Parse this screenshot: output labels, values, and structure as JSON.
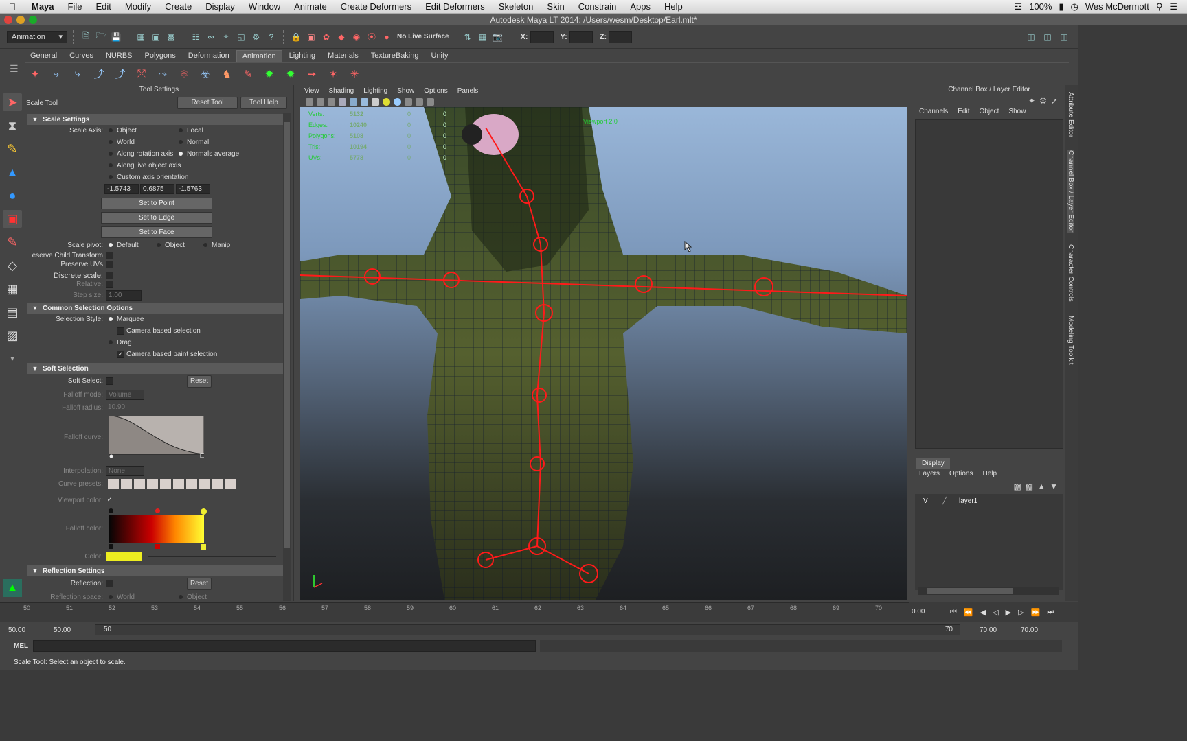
{
  "menubar": {
    "items": [
      "Maya",
      "File",
      "Edit",
      "Modify",
      "Create",
      "Display",
      "Window",
      "Animate",
      "Create Deformers",
      "Edit Deformers",
      "Skeleton",
      "Skin",
      "Constrain",
      "Apps",
      "Help"
    ],
    "battery": "100%",
    "user": "Wes McDermott"
  },
  "window": {
    "title": "Autodesk Maya LT 2014: /Users/wesm/Desktop/Earl.mlt*"
  },
  "statusline": {
    "mode": "Animation",
    "live_surface": "No Live Surface",
    "x_label": "X:",
    "y_label": "Y:",
    "z_label": "Z:"
  },
  "shelf": {
    "tabs": [
      "General",
      "Curves",
      "NURBS",
      "Polygons",
      "Deformation",
      "Animation",
      "Lighting",
      "Materials",
      "TextureBaking",
      "Unity"
    ],
    "active_tab": "Animation"
  },
  "tool_settings": {
    "header": "Tool Settings",
    "tool_name": "Scale Tool",
    "reset_tool": "Reset Tool",
    "tool_help": "Tool Help",
    "scale_settings": {
      "title": "Scale Settings",
      "axis_label": "Scale Axis:",
      "object": "Object",
      "local": "Local",
      "world": "World",
      "normal": "Normal",
      "along_rotation": "Along rotation axis",
      "normals_average": "Normals average",
      "along_live": "Along live object axis",
      "custom": "Custom axis orientation",
      "v1": "-1.5743",
      "v2": "0.6875",
      "v3": "-1.5763",
      "set_point": "Set to Point",
      "set_edge": "Set to Edge",
      "set_face": "Set to Face",
      "pivot_label": "Scale pivot:",
      "pivot_default": "Default",
      "pivot_object": "Object",
      "pivot_manip": "Manip",
      "preserve_child": "eserve Child Transform",
      "preserve_uvs": "Preserve UVs",
      "discrete": "Discrete scale:",
      "relative": "Relative:",
      "step_size": "Step size:",
      "step_value": "1.00"
    },
    "common_selection": {
      "title": "Common Selection Options",
      "style_label": "Selection Style:",
      "marquee": "Marquee",
      "camera_based": "Camera based selection",
      "drag": "Drag",
      "camera_paint": "Camera based paint selection"
    },
    "soft_selection": {
      "title": "Soft Selection",
      "soft_select": "Soft Select:",
      "reset": "Reset",
      "falloff_mode": "Falloff mode:",
      "falloff_mode_value": "Volume",
      "falloff_radius": "Falloff radius:",
      "falloff_radius_value": "10.90",
      "falloff_curve": "Falloff curve:",
      "interpolation": "Interpolation:",
      "interpolation_value": "None",
      "curve_presets": "Curve presets:",
      "viewport_color": "Viewport color:",
      "falloff_color": "Falloff color:",
      "color": "Color:"
    },
    "reflection": {
      "title": "Reflection Settings",
      "reflection": "Reflection:",
      "reset": "Reset",
      "space": "Reflection space:",
      "world": "World",
      "object": "Object"
    }
  },
  "viewport": {
    "menu": [
      "View",
      "Shading",
      "Lighting",
      "Show",
      "Options",
      "Panels"
    ],
    "hud": [
      {
        "name": "Verts:",
        "v": "5132",
        "s": "0",
        "z": "0"
      },
      {
        "name": "Edges:",
        "v": "10240",
        "s": "0",
        "z": "0"
      },
      {
        "name": "Polygons:",
        "v": "5108",
        "s": "0",
        "z": "0"
      },
      {
        "name": "Tris:",
        "v": "10194",
        "s": "0",
        "z": "0"
      },
      {
        "name": "UVs:",
        "v": "5778",
        "s": "0",
        "z": "0"
      }
    ],
    "renderer": "Viewport 2.0"
  },
  "channel_box": {
    "title": "Channel Box / Layer Editor",
    "menu": [
      "Channels",
      "Edit",
      "Object",
      "Show"
    ],
    "display_tab": "Display",
    "layer_menu": [
      "Layers",
      "Options",
      "Help"
    ],
    "layer": {
      "v": "V",
      "name": "layer1"
    },
    "side_tabs": [
      "Attribute Editor",
      "Channel Box / Layer Editor",
      "Character Controls",
      "Modeling Toolkit"
    ]
  },
  "timeline": {
    "ticks": [
      "50",
      "51",
      "52",
      "53",
      "54",
      "55",
      "56",
      "57",
      "58",
      "59",
      "60",
      "61",
      "62",
      "63",
      "64",
      "65",
      "66",
      "67",
      "68",
      "69",
      "70"
    ],
    "current_frame": "0.00"
  },
  "range": {
    "start": "50.00",
    "inner_start": "50.00",
    "slider_start": "50",
    "slider_end": "70",
    "inner_end": "70.00",
    "end": "70.00"
  },
  "command": {
    "label": "MEL"
  },
  "help": {
    "text": "Scale Tool: Select an object to scale."
  }
}
